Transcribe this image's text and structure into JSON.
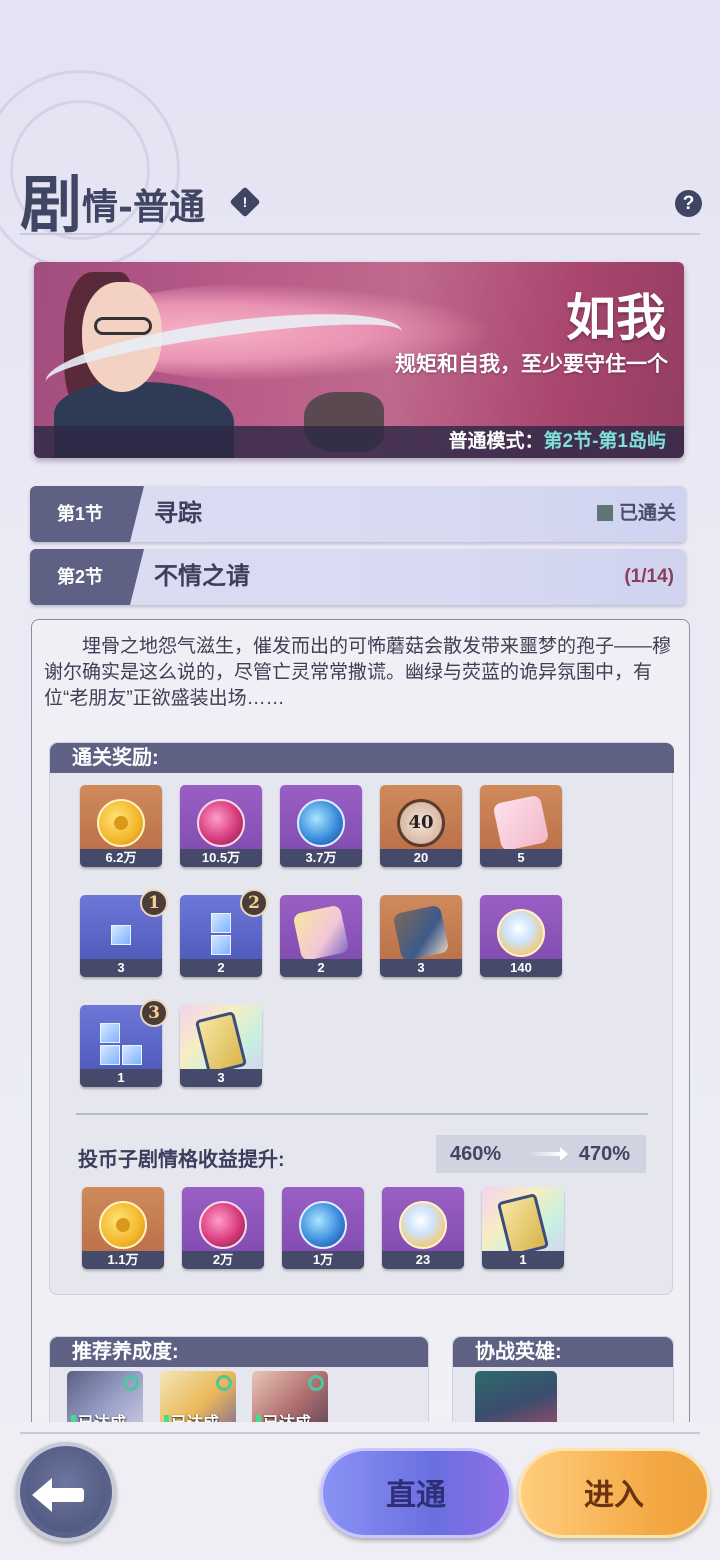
{
  "header": {
    "title_big": "剧",
    "title_rest": "情-普通",
    "info_icon": "!",
    "help_icon": "?"
  },
  "banner": {
    "title": "如我",
    "subtitle": "规矩和自我，至少要守住一个",
    "mode_label": "普通模式：",
    "mode_value": "第2节-第1岛屿"
  },
  "chapters": [
    {
      "tag": "第1节",
      "name": "寻踪",
      "status": "已通关"
    },
    {
      "tag": "第2节",
      "name": "不情之请",
      "progress": "(1/14)"
    }
  ],
  "description": "埋骨之地怨气滋生，催发而出的可怖蘑菇会散发带来噩梦的孢子——穆谢尔确实是这么说的，尽管亡灵常常撒谎。幽绿与荧蓝的诡异氛围中，有位“老朋友”正欲盛装出场……",
  "rewards": {
    "title": "通关奖励:",
    "items": [
      {
        "icon": "gold-coin",
        "count": "6.2万",
        "rank": ""
      },
      {
        "icon": "pink-orb",
        "count": "10.5万",
        "rank": ""
      },
      {
        "icon": "blue-orb",
        "count": "3.7万",
        "rank": ""
      },
      {
        "icon": "badge-40",
        "count": "20",
        "rank": "",
        "badge_text": "40"
      },
      {
        "icon": "puzzle-piece",
        "count": "5",
        "rank": ""
      },
      {
        "icon": "diamond-block-1",
        "count": "3",
        "rank": "1"
      },
      {
        "icon": "diamond-block-2",
        "count": "2",
        "rank": "2"
      },
      {
        "icon": "puzzle-piece-blonde",
        "count": "2",
        "rank": ""
      },
      {
        "icon": "puzzle-piece-blue",
        "count": "3",
        "rank": ""
      },
      {
        "icon": "crystal-gem",
        "count": "140",
        "rank": ""
      },
      {
        "icon": "diamond-block-3",
        "count": "1",
        "rank": "3"
      },
      {
        "icon": "gold-card",
        "count": "3",
        "rank": ""
      }
    ]
  },
  "coin_boost": {
    "label": "投币子剧情格收益提升:",
    "from": "460%",
    "to": "470%",
    "items": [
      {
        "icon": "gold-coin",
        "count": "1.1万"
      },
      {
        "icon": "pink-orb",
        "count": "2万"
      },
      {
        "icon": "blue-orb",
        "count": "1万"
      },
      {
        "icon": "crystal-gem",
        "count": "23"
      },
      {
        "icon": "gold-card",
        "count": "1"
      }
    ]
  },
  "recommend": {
    "title": "推荐养成度:",
    "heroes": [
      "已达成",
      "已达成",
      "已达成"
    ]
  },
  "assist": {
    "title": "协战英雄:"
  },
  "buttons": {
    "direct": "直通",
    "enter": "进入"
  },
  "colors": {
    "header_dark": "#3f4563",
    "tag_bg": "#5e6184",
    "direct_btn": "#6a6fe0",
    "enter_btn": "#f4a945",
    "accent_teal": "#7fe0d8"
  }
}
